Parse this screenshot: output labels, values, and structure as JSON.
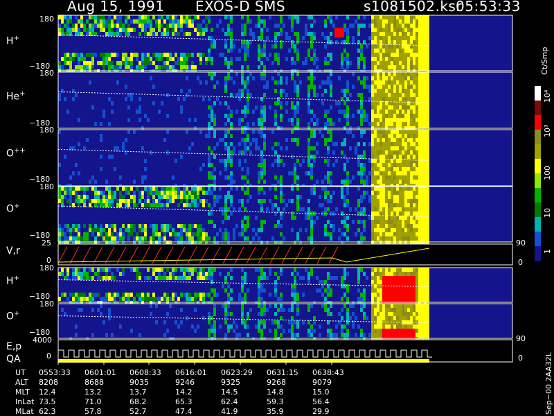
{
  "header": {
    "date": "Aug 15, 1991",
    "instrument": "EXOS-D SMS",
    "file": "s1081502.ksr",
    "time": "05:53:33"
  },
  "panels": [
    {
      "label": "H",
      "sup": "+",
      "top_tick": "180",
      "bottom_tick": "−180"
    },
    {
      "label": "He",
      "sup": "+",
      "top_tick": "180",
      "bottom_tick": "−180"
    },
    {
      "label": "O",
      "sup": "++",
      "top_tick": "180",
      "bottom_tick": "−180"
    },
    {
      "label": "O",
      "sup": "+",
      "top_tick": "180",
      "bottom_tick": "−180"
    },
    {
      "label": "V,r",
      "sup": "",
      "top_tick": "25",
      "bottom_tick": "0",
      "right_top": "90",
      "right_bottom": "0"
    },
    {
      "label": "H",
      "sup": "+",
      "top_tick": "180",
      "bottom_tick": "−180"
    },
    {
      "label": "O",
      "sup": "+",
      "top_tick": "180",
      "bottom_tick": "−180",
      "right_bottom": "90"
    },
    {
      "label": "E,p",
      "label2": "QA",
      "sup": "",
      "top_tick": "4000",
      "bottom_tick": "0",
      "right_bottom": "0"
    }
  ],
  "colorbar": {
    "unit": "Ct/Smp",
    "labels": [
      "10⁴",
      "10³",
      "100",
      "10",
      "1"
    ],
    "colors": [
      "#ffffff",
      "#7a0a0a",
      "#ff0000",
      "#8c8c1a",
      "#a0a000",
      "#ffff00",
      "#8fe600",
      "#00b400",
      "#007a00",
      "#00b4b4",
      "#1450d2",
      "#14148c"
    ]
  },
  "footer": {
    "row_labels": [
      "UT",
      "ALT",
      "MLT",
      "InLat",
      "MLat"
    ],
    "columns": [
      [
        "0553:33",
        "8208",
        "12.4",
        "73.5",
        "62.3"
      ],
      [
        "0601:01",
        "8688",
        "13.2",
        "71.0",
        "57.8"
      ],
      [
        "0608:33",
        "9035",
        "13.7",
        "68.2",
        "52.7"
      ],
      [
        "0616:01",
        "9246",
        "14.2",
        "65.3",
        "47.4"
      ],
      [
        "0623:29",
        "9325",
        "14.5",
        "62.4",
        "41.9"
      ],
      [
        "0631:15",
        "9268",
        "14.8",
        "59.3",
        "35.9"
      ],
      [
        "0638:43",
        "9079",
        "15.0",
        "56.4",
        "29.9"
      ]
    ],
    "stamp": "Sep−00 2AA32L"
  },
  "chart_data": {
    "type": "heatmap",
    "title": "Aug 15, 1991   EXOS-D SMS",
    "x_tick_labels": [
      "0553:33",
      "0601:01",
      "0608:33",
      "0616:01",
      "0623:29",
      "0631:15",
      "0638:43"
    ],
    "color_scale": {
      "label": "Ct/Smp",
      "range": [
        1,
        10000
      ],
      "log": true
    },
    "panels": [
      "H+",
      "He+",
      "O++",
      "O+",
      "V,r",
      "H+",
      "O+",
      "E,p / QA"
    ]
  }
}
